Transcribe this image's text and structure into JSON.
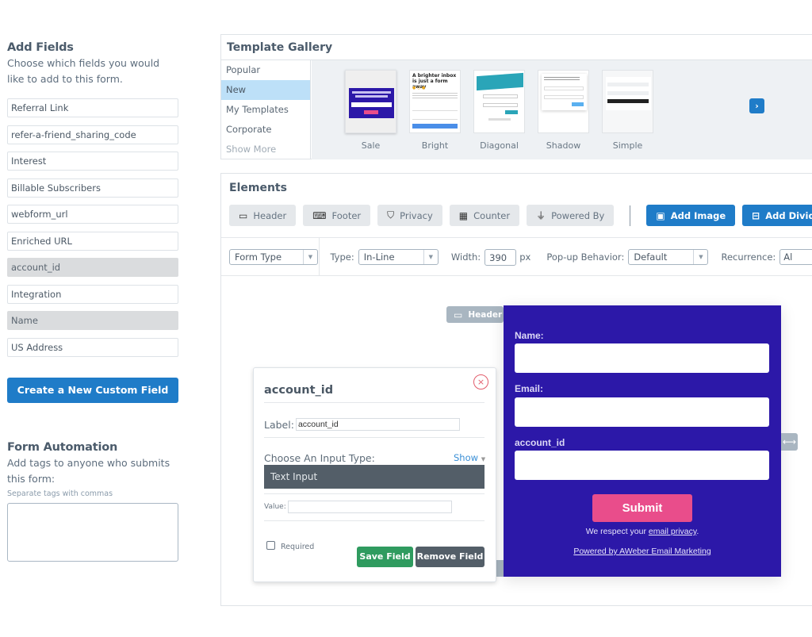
{
  "add_fields": {
    "title": "Add Fields",
    "description": "Choose which fields you would like to add to this form.",
    "fields": [
      {
        "label": "Referral Link",
        "used": false
      },
      {
        "label": "refer-a-friend_sharing_code",
        "used": false
      },
      {
        "label": "Interest",
        "used": false
      },
      {
        "label": "Billable Subscribers",
        "used": false
      },
      {
        "label": "webform_url",
        "used": false
      },
      {
        "label": "Enriched URL",
        "used": false
      },
      {
        "label": "account_id",
        "used": true
      },
      {
        "label": "Integration",
        "used": false
      },
      {
        "label": "Name",
        "used": true
      },
      {
        "label": "US Address",
        "used": false
      }
    ],
    "create_button": "Create a New Custom Field"
  },
  "automation": {
    "title": "Form Automation",
    "description": "Add tags to anyone who submits this form:",
    "hint": "Separate tags with commas",
    "tags_value": ""
  },
  "gallery": {
    "title": "Template Gallery",
    "categories": [
      {
        "label": "Popular",
        "active": false
      },
      {
        "label": "New",
        "active": true
      },
      {
        "label": "My Templates",
        "active": false
      },
      {
        "label": "Corporate",
        "active": false
      }
    ],
    "show_more": "Show More",
    "templates": [
      {
        "name": "Sale"
      },
      {
        "name": "Bright",
        "headline": "A brighter inbox is just a form away"
      },
      {
        "name": "Diagonal"
      },
      {
        "name": "Shadow"
      },
      {
        "name": "Simple"
      }
    ],
    "next_icon": "chevron-right-icon"
  },
  "elements": {
    "title": "Elements",
    "chips": [
      {
        "label": "Header",
        "icon": "header-icon",
        "glyph": "▭"
      },
      {
        "label": "Footer",
        "icon": "footer-icon",
        "glyph": "⌨"
      },
      {
        "label": "Privacy",
        "icon": "shield-icon",
        "glyph": "⛉"
      },
      {
        "label": "Counter",
        "icon": "counter-icon",
        "glyph": "▦"
      },
      {
        "label": "Powered By",
        "icon": "plug-icon",
        "glyph": "⏚"
      }
    ],
    "actions": [
      {
        "label": "Add Image",
        "icon": "image-icon",
        "glyph": "▣"
      },
      {
        "label": "Add Divider",
        "icon": "divider-icon",
        "glyph": "⊟"
      },
      {
        "label": "",
        "icon": "text-icon",
        "glyph": "T"
      }
    ]
  },
  "toolbar": {
    "form_type": "Form Type",
    "type_label": "Type:",
    "type_value": "In-Line",
    "width_label": "Width:",
    "width_value": "390",
    "width_unit": "px",
    "popup_label": "Pop-up Behavior:",
    "popup_value": "Default",
    "recurrence_label": "Recurrence:",
    "recurrence_value": "Al"
  },
  "canvas": {
    "header_tag": "Header",
    "resize_glyph": "⟷",
    "form": {
      "fields": [
        {
          "label": "Name:"
        },
        {
          "label": "Email:"
        },
        {
          "label": "account_id"
        }
      ],
      "submit": "Submit",
      "privacy_prefix": "We respect your ",
      "privacy_link": "email privacy",
      "privacy_suffix": ".",
      "powered_by": "Powered by AWeber Email Marketing",
      "background": "#2c18a8",
      "submit_color": "#e94d8b"
    }
  },
  "editor": {
    "title": "account_id",
    "close_glyph": "×",
    "label_label": "Label:",
    "label_value": "account_id",
    "choose_type": "Choose An Input Type:",
    "show_link": "Show",
    "input_type": "Text Input",
    "value_label": "Value:",
    "value_value": "",
    "required_label": "Required",
    "required_checked": false,
    "save_button": "Save Field",
    "remove_button": "Remove Field"
  }
}
